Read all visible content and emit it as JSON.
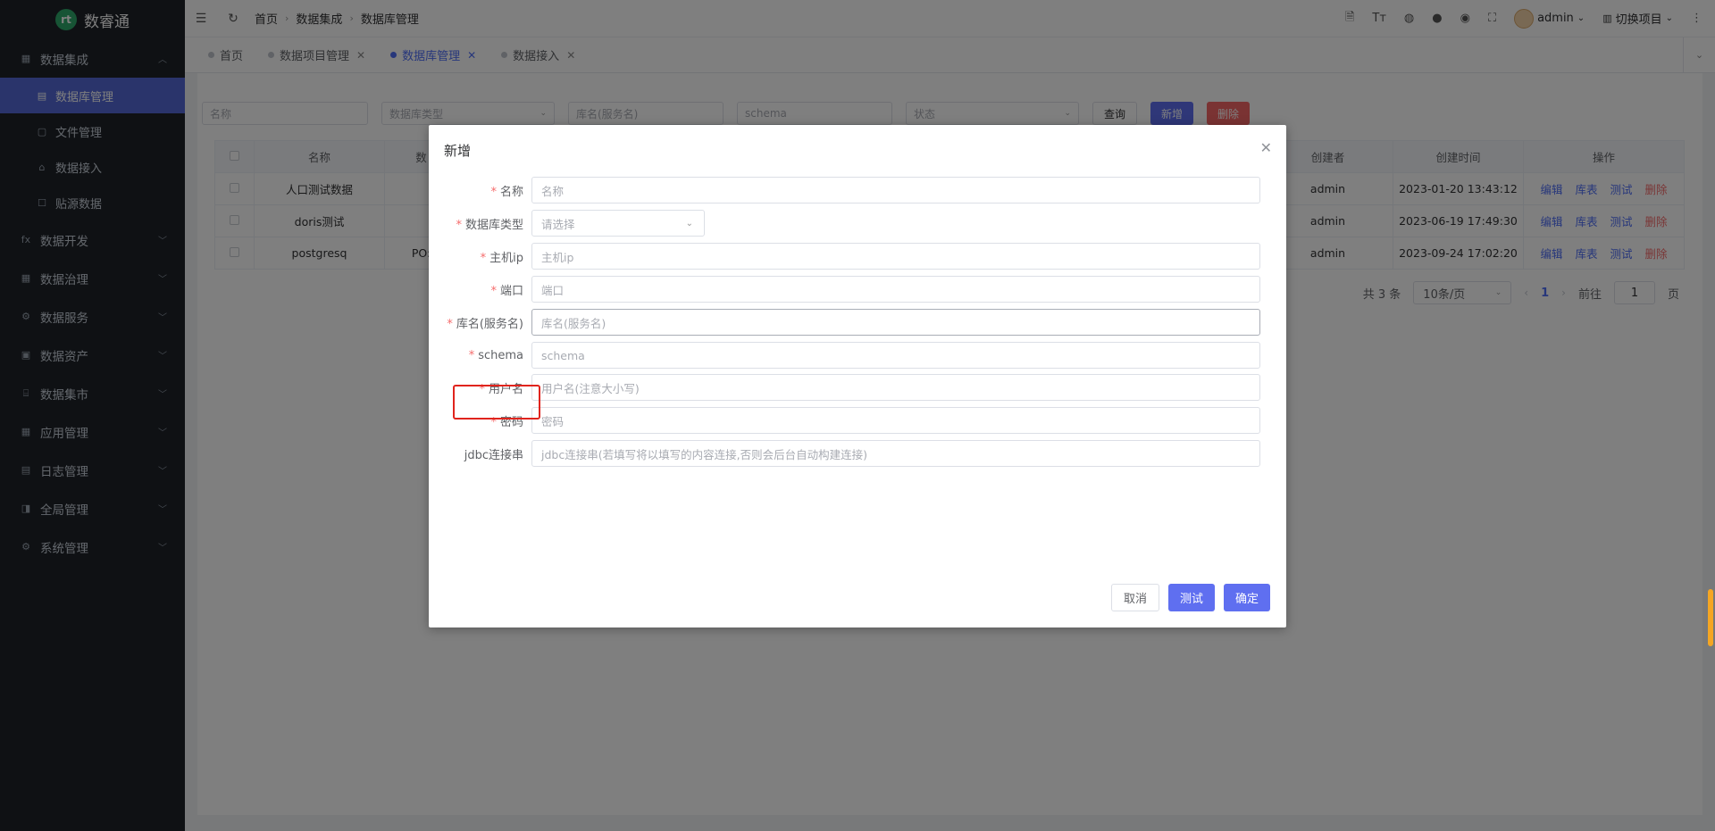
{
  "app": {
    "name": "数睿通",
    "logo_text": "rt"
  },
  "sidebar": {
    "groups": [
      {
        "label": "数据集成",
        "icon": "grid-icon",
        "glyph": "▦",
        "expanded": true,
        "children": [
          {
            "label": "数据库管理",
            "icon": "database-icon",
            "glyph": "▤",
            "active": true
          },
          {
            "label": "文件管理",
            "icon": "file-icon",
            "glyph": "▢"
          },
          {
            "label": "数据接入",
            "icon": "link-icon",
            "glyph": "⌂"
          },
          {
            "label": "贴源数据",
            "icon": "box-icon",
            "glyph": "☐"
          }
        ]
      },
      {
        "label": "数据开发",
        "icon": "function-icon",
        "glyph": "fx"
      },
      {
        "label": "数据治理",
        "icon": "table-icon",
        "glyph": "▦"
      },
      {
        "label": "数据服务",
        "icon": "settings-icon",
        "glyph": "⚙"
      },
      {
        "label": "数据资产",
        "icon": "asset-icon",
        "glyph": "▣"
      },
      {
        "label": "数据集市",
        "icon": "market-icon",
        "glyph": "⌸"
      },
      {
        "label": "应用管理",
        "icon": "apps-icon",
        "glyph": "▦"
      },
      {
        "label": "日志管理",
        "icon": "log-icon",
        "glyph": "▤"
      },
      {
        "label": "全局管理",
        "icon": "global-icon",
        "glyph": "◨"
      },
      {
        "label": "系统管理",
        "icon": "gear-icon",
        "glyph": "⚙"
      }
    ]
  },
  "header": {
    "breadcrumb": [
      "首页",
      "数据集成",
      "数据库管理"
    ],
    "user": "admin",
    "project_switch": "切换项目"
  },
  "tabs": [
    {
      "label": "首页",
      "closable": false,
      "active": false
    },
    {
      "label": "数据项目管理",
      "closable": true,
      "active": false
    },
    {
      "label": "数据库管理",
      "closable": true,
      "active": true
    },
    {
      "label": "数据接入",
      "closable": true,
      "active": false
    }
  ],
  "filters": {
    "name_placeholder": "名称",
    "db_type_placeholder": "数据库类型",
    "db_name_placeholder": "库名(服务名)",
    "schema_placeholder": "schema",
    "status_placeholder": "状态",
    "query_label": "查询",
    "add_label": "新增",
    "delete_label": "删除"
  },
  "table": {
    "headers": [
      "名称",
      "数",
      "创建者",
      "创建时间",
      "操作"
    ],
    "rows": [
      {
        "name": "人口测试数据",
        "type": "",
        "creator": "admin",
        "created": "2023-01-20 13:43:12"
      },
      {
        "name": "doris测试",
        "type": "",
        "creator": "admin",
        "created": "2023-06-19 17:49:30"
      },
      {
        "name": "postgresq",
        "type": "PO:",
        "creator": "admin",
        "created": "2023-09-24 17:02:20"
      }
    ],
    "ops": {
      "edit": "编辑",
      "tables": "库表",
      "test": "测试",
      "delete": "删除"
    }
  },
  "pager": {
    "total": "共 3 条",
    "page_size": "10条/页",
    "current": "1",
    "goto_label": "前往",
    "goto_value": "1",
    "page_unit": "页"
  },
  "dialog": {
    "title": "新增",
    "fields": [
      {
        "label": "名称",
        "required": true,
        "placeholder": "名称",
        "type": "input"
      },
      {
        "label": "数据库类型",
        "required": true,
        "placeholder": "请选择",
        "type": "select"
      },
      {
        "label": "主机ip",
        "required": true,
        "placeholder": "主机ip",
        "type": "input"
      },
      {
        "label": "端口",
        "required": true,
        "placeholder": "端口",
        "type": "input"
      },
      {
        "label": "库名(服务名)",
        "required": true,
        "placeholder": "库名(服务名)",
        "type": "input"
      },
      {
        "label": "schema",
        "required": true,
        "placeholder": "schema",
        "type": "input"
      },
      {
        "label": "用户名",
        "required": true,
        "placeholder": "用户名(注意大小写)",
        "type": "input"
      },
      {
        "label": "密码",
        "required": true,
        "placeholder": "密码",
        "type": "input"
      },
      {
        "label": "jdbc连接串",
        "required": false,
        "placeholder": "jdbc连接串(若填写将以填写的内容连接,否则会后台自动构建连接)",
        "type": "input"
      }
    ],
    "cancel_label": "取消",
    "test_label": "测试",
    "ok_label": "确定"
  },
  "colors": {
    "accent": "#5f6ff0",
    "sidebar_bg": "#1f2329",
    "danger": "#f56c6c",
    "highlight": "#e0241d"
  }
}
